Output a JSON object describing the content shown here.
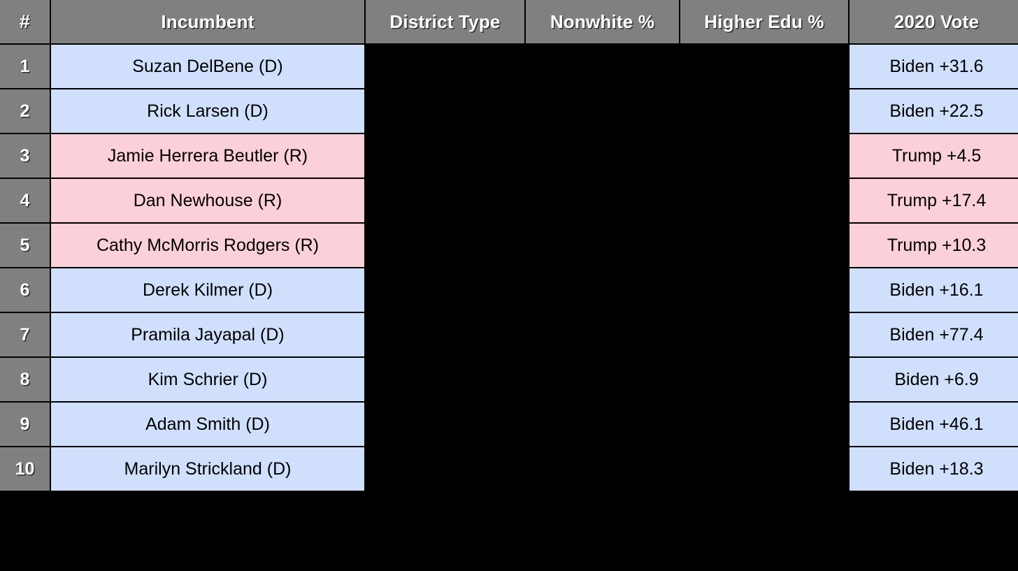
{
  "table": {
    "columns": [
      {
        "key": "rank",
        "label": "#"
      },
      {
        "key": "name",
        "label": "Incumbent"
      },
      {
        "key": "dtype",
        "label": "District Type"
      },
      {
        "key": "nw",
        "label": "Nonwhite %"
      },
      {
        "key": "edu",
        "label": "Higher Edu %"
      },
      {
        "key": "vote",
        "label": "2020 Vote"
      }
    ],
    "rows": [
      {
        "rank": "1",
        "name": "Suzan DelBene (D)",
        "party": "D",
        "dtype": "",
        "nw": "",
        "edu": "",
        "vote": "Biden +31.6"
      },
      {
        "rank": "2",
        "name": "Rick Larsen (D)",
        "party": "D",
        "dtype": "",
        "nw": "",
        "edu": "",
        "vote": "Biden +22.5"
      },
      {
        "rank": "3",
        "name": "Jamie Herrera Beutler (R)",
        "party": "R",
        "dtype": "",
        "nw": "",
        "edu": "",
        "vote": "Trump +4.5"
      },
      {
        "rank": "4",
        "name": "Dan Newhouse (R)",
        "party": "R",
        "dtype": "",
        "nw": "",
        "edu": "",
        "vote": "Trump +17.4"
      },
      {
        "rank": "5",
        "name": "Cathy McMorris Rodgers (R)",
        "party": "R",
        "dtype": "",
        "nw": "",
        "edu": "",
        "vote": "Trump +10.3"
      },
      {
        "rank": "6",
        "name": "Derek Kilmer (D)",
        "party": "D",
        "dtype": "",
        "nw": "",
        "edu": "",
        "vote": "Biden +16.1"
      },
      {
        "rank": "7",
        "name": "Pramila Jayapal (D)",
        "party": "D",
        "dtype": "",
        "nw": "",
        "edu": "",
        "vote": "Biden +77.4"
      },
      {
        "rank": "8",
        "name": "Kim Schrier (D)",
        "party": "D",
        "dtype": "",
        "nw": "",
        "edu": "",
        "vote": "Biden +6.9"
      },
      {
        "rank": "9",
        "name": "Adam Smith (D)",
        "party": "D",
        "dtype": "",
        "nw": "",
        "edu": "",
        "vote": "Biden +46.1"
      },
      {
        "rank": "10",
        "name": "Marilyn Strickland (D)",
        "party": "D",
        "dtype": "",
        "nw": "",
        "edu": "",
        "vote": "Biden +18.3"
      }
    ]
  },
  "colors": {
    "background": "#000000",
    "header_fill": "#808080",
    "header_text": "#ffffff",
    "democrat_fill": "#d0e0fc",
    "republican_fill": "#fcd0d9",
    "body_text": "#000000"
  }
}
